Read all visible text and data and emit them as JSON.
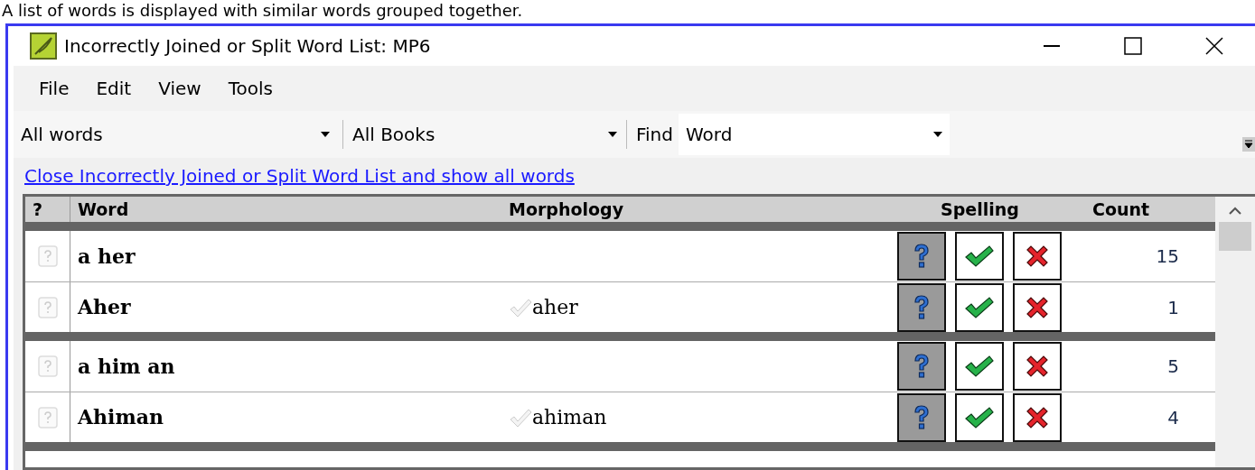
{
  "caption": "A list of words is displayed with similar words grouped together.",
  "window": {
    "title": "Incorrectly Joined or Split Word List: MP6"
  },
  "menu": [
    "File",
    "Edit",
    "View",
    "Tools"
  ],
  "toolbar": {
    "word_filter": "All words",
    "book_filter": "All Books",
    "find_label": "Find",
    "find_field": "Word"
  },
  "link": "Close Incorrectly Joined or Split Word List and show all words",
  "table": {
    "columns": [
      "?",
      "Word",
      "Morphology",
      "Spelling",
      "Count"
    ],
    "groups": [
      {
        "rows": [
          {
            "word": "a her",
            "spelling": [
              {
                "kind": "unknown",
                "selected": true
              },
              {
                "kind": "correct",
                "selected": false
              },
              {
                "kind": "incorrect",
                "selected": false
              }
            ],
            "count": "15"
          },
          {
            "word": "Aher",
            "morphology": "aher",
            "spelling": [
              {
                "kind": "unknown",
                "selected": true
              },
              {
                "kind": "correct",
                "selected": false
              },
              {
                "kind": "incorrect",
                "selected": false
              }
            ],
            "count": "1"
          }
        ]
      },
      {
        "rows": [
          {
            "word": "a him an",
            "spelling": [
              {
                "kind": "unknown",
                "selected": true
              },
              {
                "kind": "correct",
                "selected": false
              },
              {
                "kind": "incorrect",
                "selected": false
              }
            ],
            "count": "5"
          },
          {
            "word": "Ahiman",
            "morphology": "ahiman",
            "spelling": [
              {
                "kind": "unknown",
                "selected": true
              },
              {
                "kind": "correct",
                "selected": false
              },
              {
                "kind": "incorrect",
                "selected": false
              }
            ],
            "count": "4"
          }
        ]
      }
    ]
  }
}
